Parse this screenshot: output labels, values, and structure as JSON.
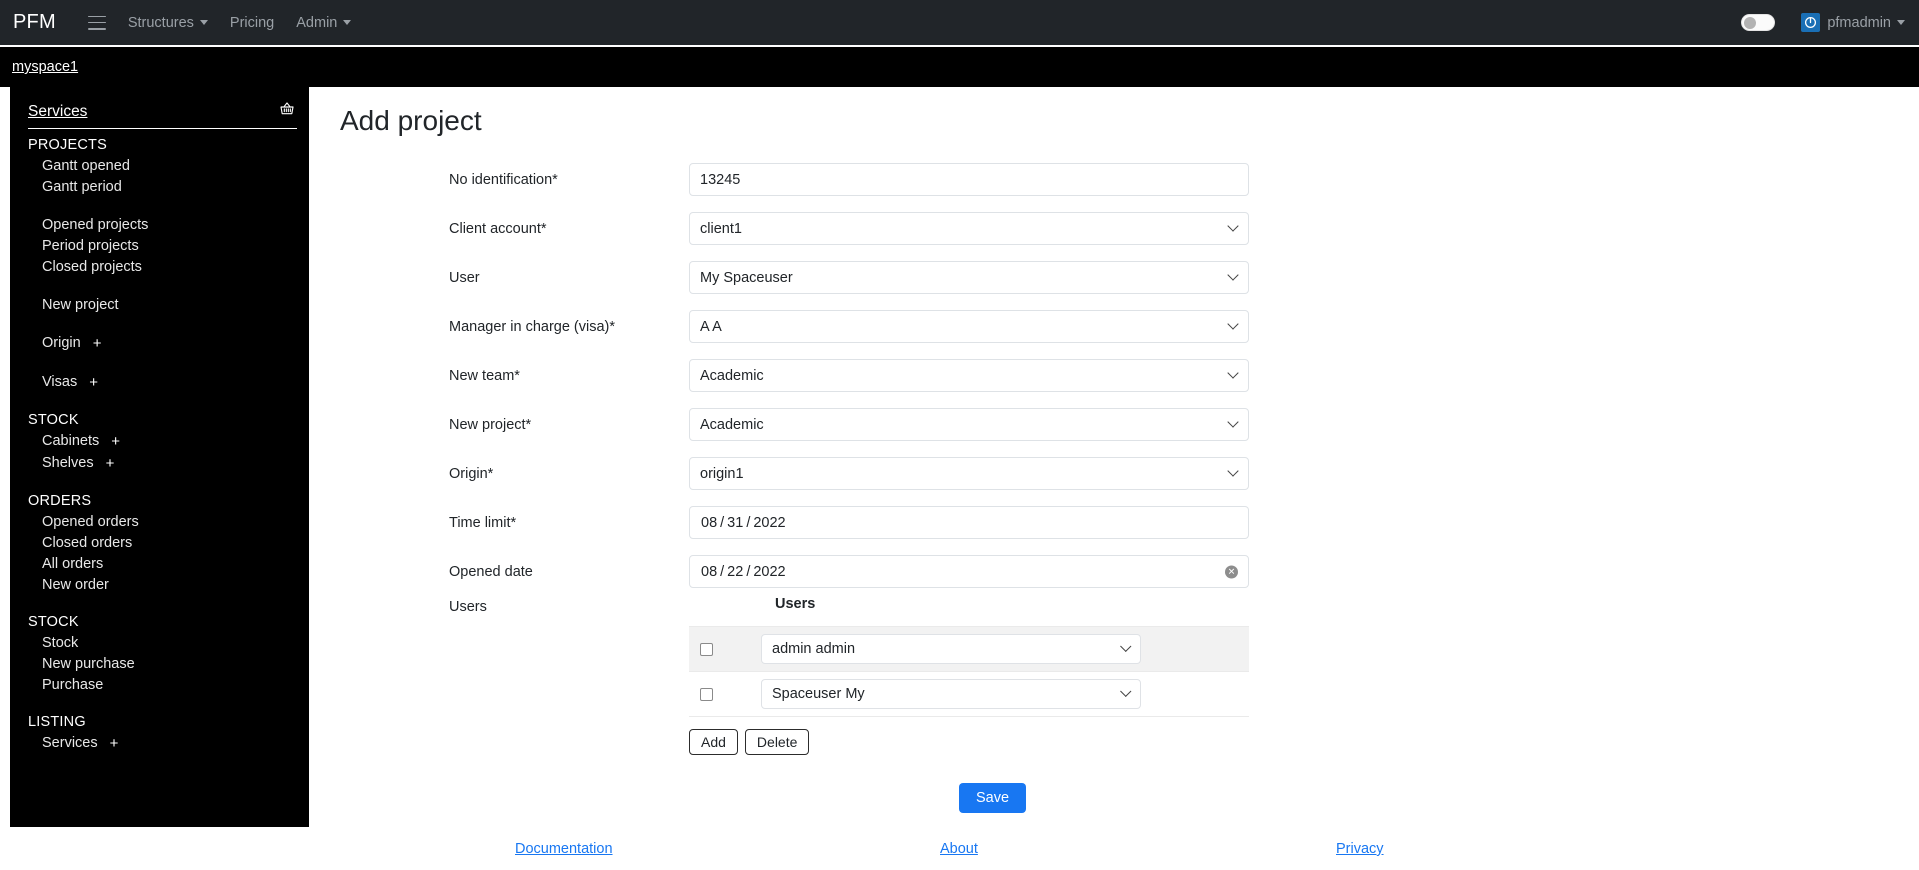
{
  "navbar": {
    "brand": "PFM",
    "menu_icon": "hamburger-icon",
    "links": [
      {
        "label": "Structures",
        "has_caret": true
      },
      {
        "label": "Pricing",
        "has_caret": false
      },
      {
        "label": "Admin",
        "has_caret": true
      }
    ],
    "theme_toggle": {
      "state": "off"
    },
    "user": {
      "name": "pfmadmin",
      "avatar_icon": "power-circle-icon",
      "avatar_color": "#1a6fb5",
      "has_caret": true
    }
  },
  "breadcrumb": {
    "label": "myspace1"
  },
  "sidebar": {
    "header": {
      "title": "Services",
      "icon": "shopping-basket-icon"
    },
    "groups": [
      {
        "title": "PROJECTS",
        "blocks": [
          [
            {
              "label": "Gantt opened"
            },
            {
              "label": "Gantt period"
            }
          ],
          [
            {
              "label": "Opened projects"
            },
            {
              "label": "Period projects"
            },
            {
              "label": "Closed projects"
            }
          ],
          [
            {
              "label": "New project"
            }
          ],
          [
            {
              "label": "Origin",
              "plus": "+"
            }
          ],
          [
            {
              "label": "Visas",
              "plus": "+"
            }
          ]
        ]
      },
      {
        "title": "STOCK",
        "blocks": [
          [
            {
              "label": "Cabinets",
              "plus": "+"
            },
            {
              "label": "Shelves",
              "plus": "+"
            }
          ]
        ]
      },
      {
        "title": "ORDERS",
        "blocks": [
          [
            {
              "label": "Opened orders"
            },
            {
              "label": "Closed orders"
            },
            {
              "label": "All orders"
            },
            {
              "label": "New order"
            }
          ]
        ]
      },
      {
        "title": "STOCK",
        "blocks": [
          [
            {
              "label": "Stock"
            },
            {
              "label": "New purchase"
            },
            {
              "label": "Purchase"
            }
          ]
        ]
      },
      {
        "title": "LISTING",
        "blocks": [
          [
            {
              "label": "Services",
              "plus": "+"
            }
          ]
        ]
      }
    ]
  },
  "page": {
    "title": "Add project",
    "fields": {
      "no_identification": {
        "label": "No identification*",
        "value": "13245",
        "type": "text"
      },
      "client_account": {
        "label": "Client account*",
        "value": "client1",
        "type": "select"
      },
      "user": {
        "label": "User",
        "value": "My Spaceuser",
        "type": "select"
      },
      "manager": {
        "label": "Manager in charge (visa)*",
        "value": "A A",
        "type": "select"
      },
      "new_team": {
        "label": "New team*",
        "value": "Academic",
        "type": "select"
      },
      "new_project": {
        "label": "New project*",
        "value": "Academic",
        "type": "select"
      },
      "origin": {
        "label": "Origin*",
        "value": "origin1",
        "type": "select"
      },
      "time_limit": {
        "label": "Time limit*",
        "month": "08",
        "day": "31",
        "year": "2022",
        "type": "date"
      },
      "opened_date": {
        "label": "Opened date",
        "month": "08",
        "day": "22",
        "year": "2022",
        "type": "date",
        "clear_icon": "clear-circle-icon"
      }
    },
    "users_section": {
      "label": "Users",
      "column_header": "Users",
      "rows": [
        {
          "checked": false,
          "value": "admin admin"
        },
        {
          "checked": false,
          "value": "Spaceuser My"
        }
      ],
      "add_label": "Add",
      "delete_label": "Delete"
    },
    "save_label": "Save"
  },
  "footer": {
    "links": [
      {
        "label": "Documentation"
      },
      {
        "label": "About"
      },
      {
        "label": "Privacy"
      }
    ]
  },
  "colors": {
    "navbar_bg": "#212529",
    "breadcrumb_bg": "#000000",
    "sidebar_bg": "#000000",
    "accent": "#1877f2",
    "avatar": "#1a6fb5"
  }
}
